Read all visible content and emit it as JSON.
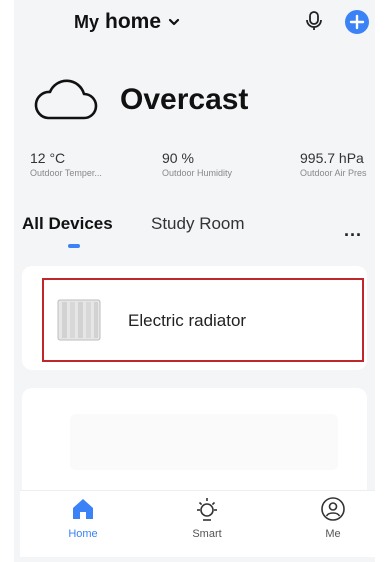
{
  "header": {
    "prefix": "My",
    "home_name": "home"
  },
  "weather": {
    "condition": "Overcast",
    "stats": [
      {
        "value": "12 °C",
        "label": "Outdoor Temper..."
      },
      {
        "value": "90 %",
        "label": "Outdoor Humidity"
      },
      {
        "value": "995.7 hPa",
        "label": "Outdoor Air Pres"
      }
    ]
  },
  "tabs": [
    {
      "label": "All Devices",
      "active": true
    },
    {
      "label": "Study Room",
      "active": false
    }
  ],
  "more": "...",
  "devices": [
    {
      "name": "Electric radiator",
      "icon": "radiator-icon"
    }
  ],
  "nav": [
    {
      "label": "Home",
      "icon": "home-icon",
      "active": true
    },
    {
      "label": "Smart",
      "icon": "sun-icon",
      "active": false
    },
    {
      "label": "Me",
      "icon": "user-icon",
      "active": false
    }
  ],
  "colors": {
    "accent": "#3b82f6",
    "highlight": "#c0272d",
    "background": "#f4f5f7"
  }
}
